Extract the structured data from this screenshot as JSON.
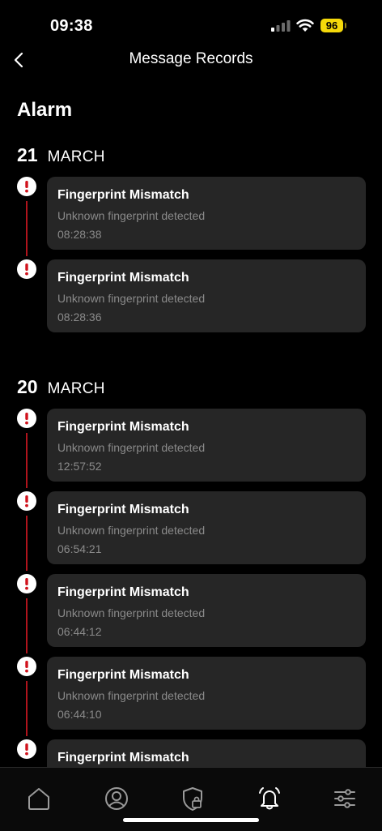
{
  "status_bar": {
    "time": "09:38",
    "battery": "96",
    "battery_color": "#f5d90a"
  },
  "header": {
    "title": "Message Records",
    "back_icon": "chevron-left-icon"
  },
  "section": {
    "title": "Alarm"
  },
  "groups": [
    {
      "day": "21",
      "month": "MARCH",
      "records": [
        {
          "title": "Fingerprint Mismatch",
          "description": "Unknown fingerprint detected",
          "time": "08:28:38"
        },
        {
          "title": "Fingerprint Mismatch",
          "description": "Unknown fingerprint detected",
          "time": "08:28:36"
        }
      ]
    },
    {
      "day": "20",
      "month": "MARCH",
      "records": [
        {
          "title": "Fingerprint Mismatch",
          "description": "Unknown fingerprint detected",
          "time": "12:57:52"
        },
        {
          "title": "Fingerprint Mismatch",
          "description": "Unknown fingerprint detected",
          "time": "06:54:21"
        },
        {
          "title": "Fingerprint Mismatch",
          "description": "Unknown fingerprint detected",
          "time": "06:44:12"
        },
        {
          "title": "Fingerprint Mismatch",
          "description": "Unknown fingerprint detected",
          "time": "06:44:10"
        },
        {
          "title": "Fingerprint Mismatch",
          "description": "",
          "time": ""
        }
      ]
    }
  ],
  "colors": {
    "accent_red": "#d1121c",
    "timeline_red": "#b0141c",
    "card_bg": "#262626",
    "muted_text": "#8a8a8a"
  },
  "tab_bar": {
    "items": [
      {
        "name": "home",
        "icon": "home-icon",
        "active": false
      },
      {
        "name": "profile",
        "icon": "user-circle-icon",
        "active": false
      },
      {
        "name": "security",
        "icon": "shield-lock-icon",
        "active": false
      },
      {
        "name": "alarm",
        "icon": "bell-ring-icon",
        "active": true
      },
      {
        "name": "settings",
        "icon": "sliders-icon",
        "active": false
      }
    ]
  }
}
